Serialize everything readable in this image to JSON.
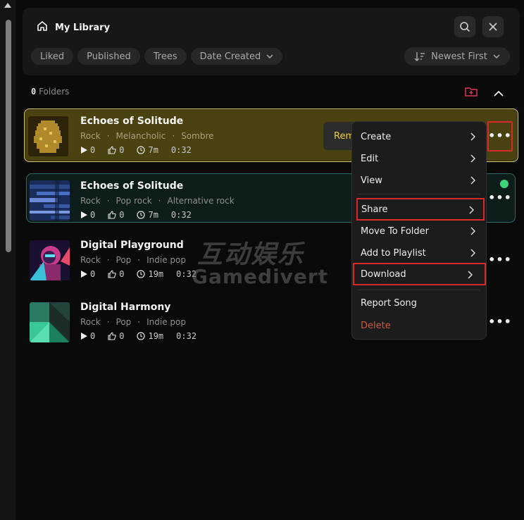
{
  "header": {
    "title": "My Library",
    "filters": [
      "Liked",
      "Published",
      "Trees",
      "Date Created"
    ],
    "sort_label": "Newest First"
  },
  "folders": {
    "count": "0",
    "label": "Folders"
  },
  "songs": [
    {
      "title": "Echoes of Solitude",
      "tags": [
        "Rock",
        "·",
        "Melancholic",
        "·",
        "Sombre"
      ],
      "plays": "0",
      "likes": "0",
      "age": "7m",
      "duration": "0:32"
    },
    {
      "title": "Echoes of Solitude",
      "tags": [
        "Rock",
        "·",
        "Pop rock",
        "·",
        "Alternative rock"
      ],
      "plays": "0",
      "likes": "0",
      "age": "7m",
      "duration": "0:32"
    },
    {
      "title": "Digital Playground",
      "tags": [
        "Rock",
        "·",
        "Pop",
        "·",
        "Indie pop"
      ],
      "plays": "0",
      "likes": "0",
      "age": "19m",
      "duration": "0:32"
    },
    {
      "title": "Digital Harmony",
      "tags": [
        "Rock",
        "·",
        "Pop",
        "·",
        "Indie pop"
      ],
      "plays": "0",
      "likes": "0",
      "age": "19m",
      "duration": "0:32"
    }
  ],
  "remix_label": "Rem",
  "context_menu": {
    "items": [
      "Create",
      "Edit",
      "View",
      "Share",
      "Move To Folder",
      "Add to Playlist",
      "Download",
      "Report Song",
      "Delete"
    ]
  },
  "watermark": {
    "cn": "互动娱乐",
    "en": "Gamedivert"
  },
  "colors": {
    "accent_yellow": "#e8d040",
    "selected_bg": "#4a4211",
    "active_border": "#2f6b5f",
    "status_green": "#3ed27a",
    "delete_red": "#cf5a45",
    "highlight_red": "#d82a2a"
  }
}
